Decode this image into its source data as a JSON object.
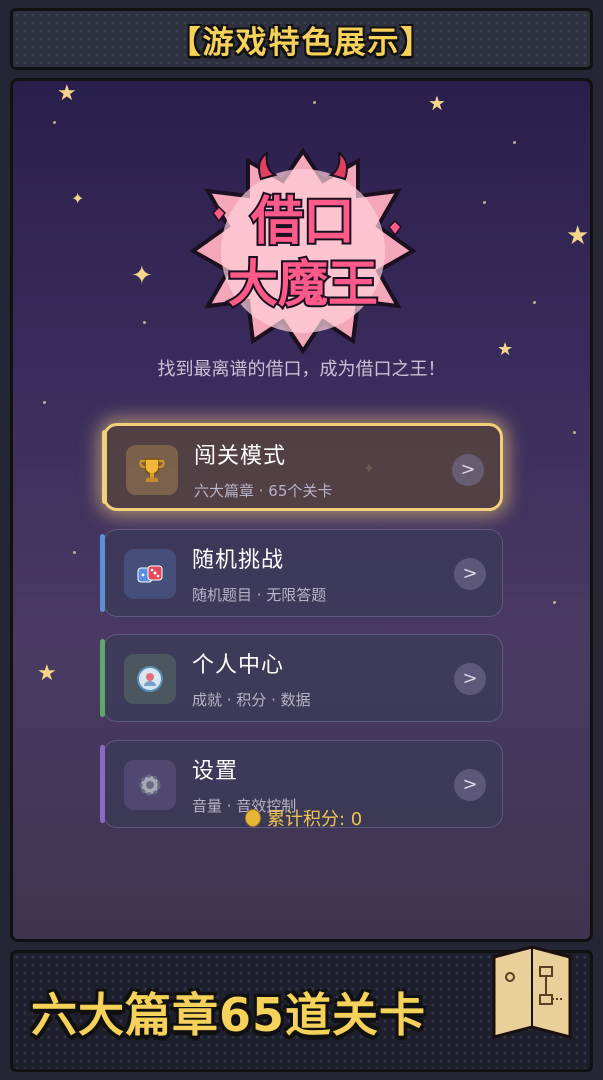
{
  "top_banner": {
    "label": "【游戏特色展示】"
  },
  "logo": {
    "line1": "借口",
    "line2": "大魔王"
  },
  "subtitle": "找到最离谱的借口，成为借口之王！",
  "menu": [
    {
      "title": "闯关模式",
      "desc": "六大篇章 · 65个关卡",
      "icon": "trophy-icon",
      "accent": "#f2cf7a",
      "arrow": ">"
    },
    {
      "title": "随机挑战",
      "desc": "随机题目 · 无限答题",
      "icon": "dice-icon",
      "accent": "#5b8fd6",
      "arrow": ">"
    },
    {
      "title": "个人中心",
      "desc": "成就 · 积分 · 数据",
      "icon": "profile-badge-icon",
      "accent": "#5fa86a",
      "arrow": ">"
    },
    {
      "title": "设置",
      "desc": "音量 · 音效控制",
      "icon": "gear-icon",
      "accent": "#8a6ac6",
      "arrow": ">"
    }
  ],
  "score": {
    "label": "累计积分: 0"
  },
  "bottom_banner": {
    "label": "六大篇章65道关卡"
  },
  "colors": {
    "gold": "#f6d25a",
    "logo_pink": "#e8407a"
  }
}
